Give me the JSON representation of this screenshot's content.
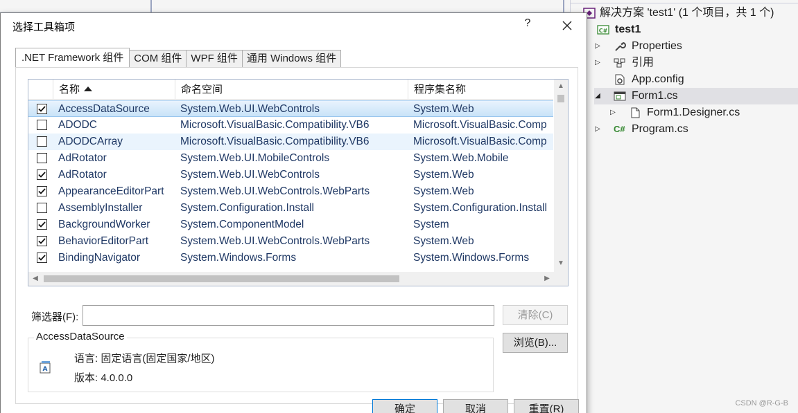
{
  "dialog": {
    "title": "选择工具箱项",
    "help": "?",
    "tabs": [
      ".NET Framework 组件",
      "COM 组件",
      "WPF 组件",
      "通用 Windows 组件"
    ],
    "columns": [
      "名称",
      "命名空间",
      "程序集名称"
    ],
    "rows": [
      {
        "checked": true,
        "name": "AccessDataSource",
        "namespace": "System.Web.UI.WebControls",
        "assembly": "System.Web"
      },
      {
        "checked": false,
        "name": "ADODC",
        "namespace": "Microsoft.VisualBasic.Compatibility.VB6",
        "assembly": "Microsoft.VisualBasic.Comp"
      },
      {
        "checked": false,
        "name": "ADODCArray",
        "namespace": "Microsoft.VisualBasic.Compatibility.VB6",
        "assembly": "Microsoft.VisualBasic.Comp"
      },
      {
        "checked": false,
        "name": "AdRotator",
        "namespace": "System.Web.UI.MobileControls",
        "assembly": "System.Web.Mobile"
      },
      {
        "checked": true,
        "name": "AdRotator",
        "namespace": "System.Web.UI.WebControls",
        "assembly": "System.Web"
      },
      {
        "checked": true,
        "name": "AppearanceEditorPart",
        "namespace": "System.Web.UI.WebControls.WebParts",
        "assembly": "System.Web"
      },
      {
        "checked": false,
        "name": "AssemblyInstaller",
        "namespace": "System.Configuration.Install",
        "assembly": "System.Configuration.Install"
      },
      {
        "checked": true,
        "name": "BackgroundWorker",
        "namespace": "System.ComponentModel",
        "assembly": "System"
      },
      {
        "checked": true,
        "name": "BehaviorEditorPart",
        "namespace": "System.Web.UI.WebControls.WebParts",
        "assembly": "System.Web"
      },
      {
        "checked": true,
        "name": "BindingNavigator",
        "namespace": "System.Windows.Forms",
        "assembly": "System.Windows.Forms"
      }
    ],
    "filter_label": "筛选器(F):",
    "filter_value": "",
    "clear_label": "清除(C)",
    "browse_label": "浏览(B)...",
    "group_title": "AccessDataSource",
    "language_text": "语言: 固定语言(固定国家/地区)",
    "version_text": "版本: 4.0.0.0",
    "ok_label": "确定",
    "cancel_label": "取消",
    "reset_label": "重置(R)"
  },
  "solution": {
    "header": "解决方案 'test1' (1 个项目，共 1 个)",
    "items": [
      "test1",
      "Properties",
      "引用",
      "App.config",
      "Form1.cs",
      "Form1.Designer.cs",
      "Program.cs"
    ],
    "icon_cs": "C#"
  },
  "watermark": "CSDN @R-G-B",
  "colors": {
    "accent": "#0078d7",
    "selection": "#c9e3f8",
    "link_text": "#1f3864"
  }
}
